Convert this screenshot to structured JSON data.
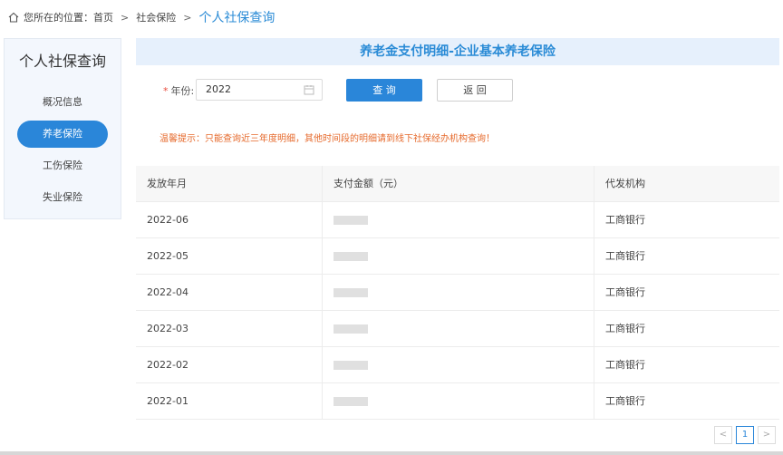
{
  "breadcrumb": {
    "prefix": "您所在的位置：",
    "home": "首页",
    "sep1": ">",
    "section": "社会保险",
    "sep2": ">",
    "current": "个人社保查询"
  },
  "sidebar": {
    "title": "个人社保查询",
    "items": [
      {
        "label": "概况信息"
      },
      {
        "label": "养老保险"
      },
      {
        "label": "工伤保险"
      },
      {
        "label": "失业保险"
      }
    ]
  },
  "main": {
    "title": "养老金支付明细-企业基本养老保险"
  },
  "query": {
    "required_mark": "*",
    "year_label": "年份:",
    "year_value": "2022",
    "search_label": "查 询",
    "back_label": "返 回"
  },
  "notice": "温馨提示：只能查询近三年度明细，其他时间段的明细请到线下社保经办机构查询！",
  "table": {
    "headers": [
      "发放年月",
      "支付金额（元）",
      "代发机构"
    ],
    "rows": [
      {
        "month": "2022-06",
        "bank": "工商银行"
      },
      {
        "month": "2022-05",
        "bank": "工商银行"
      },
      {
        "month": "2022-04",
        "bank": "工商银行"
      },
      {
        "month": "2022-03",
        "bank": "工商银行"
      },
      {
        "month": "2022-02",
        "bank": "工商银行"
      },
      {
        "month": "2022-01",
        "bank": "工商银行"
      }
    ]
  },
  "pager": {
    "prev": "<",
    "current": "1",
    "next": ">"
  },
  "colors": {
    "accent": "#2a86d9",
    "notice": "#e66a2c",
    "header_bg": "#e6f0fc"
  }
}
